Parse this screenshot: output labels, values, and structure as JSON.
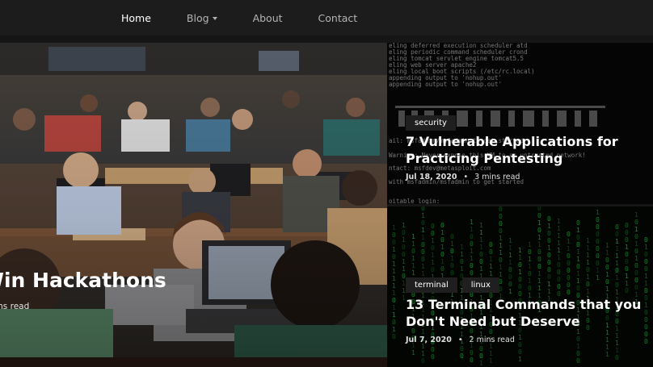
{
  "navbar": {
    "items": [
      {
        "label": "Home",
        "active": true
      },
      {
        "label": "Blog",
        "dropdown": true
      },
      {
        "label": "About"
      },
      {
        "label": "Contact"
      }
    ]
  },
  "featured": {
    "title": "on How to Win Hackathons",
    "meta": "mins read"
  },
  "cards": [
    {
      "tags": [
        "security"
      ],
      "title": "7 Vulnerable Applications for Practicing Pentesting",
      "date": "Jul 18, 2020",
      "separator": "•",
      "read_time": "3 mins read",
      "background_text": [
        "eling deferred execution scheduler atd",
        "eling periodic command scheduler crond",
        "eling tomcat servlet engine tomcat5.5",
        "eling web server apache2",
        "eling local boot scripts (/etc/rc.local)",
        " appending output to 'nohup.out'",
        " appending output to 'nohup.out'",
        "ail: msfadmin/msfadmin to get started",
        "Warning: Never expose this VM to an untrusted network!",
        "ntact: msfdev@metasploit.com",
        "with msfadmin/msfadmin to get started",
        "oitable login:"
      ]
    },
    {
      "tags": [
        "terminal",
        "linux"
      ],
      "title": "13 Terminal Commands that you Don't Need but Deserve",
      "date": "Jul 7, 2020",
      "separator": "•",
      "read_time": "2 mins read"
    }
  ],
  "colors": {
    "navbar_bg": "#1c1c1c",
    "page_bg": "#161616",
    "tag_bg": "#1f1f1f",
    "matrix_green": "#2fd14a"
  }
}
